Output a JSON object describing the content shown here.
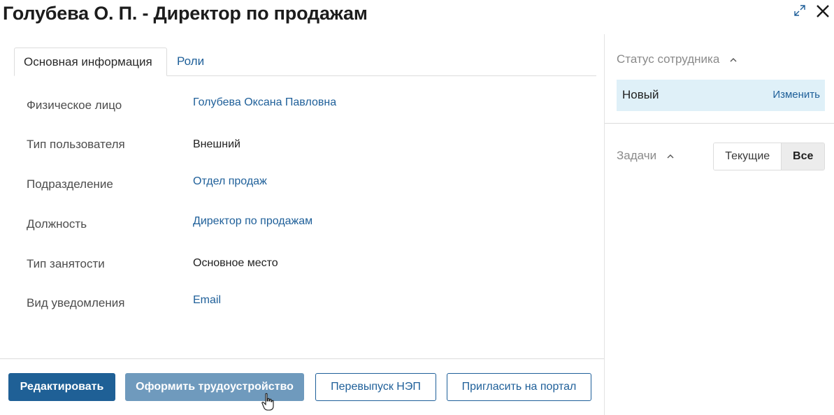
{
  "header": {
    "title": "Голубева О. П. - Директор по продажам"
  },
  "tabs": [
    {
      "label": "Основная информация",
      "active": true
    },
    {
      "label": "Роли",
      "active": false
    }
  ],
  "fields": {
    "individual": {
      "label": "Физическое лицо",
      "value": "Голубева Оксана Павловна"
    },
    "user_type": {
      "label": "Тип пользователя",
      "value": "Внешний"
    },
    "department": {
      "label": "Подразделение",
      "value": "Отдел продаж"
    },
    "position": {
      "label": "Должность",
      "value": "Директор по продажам"
    },
    "employment_type": {
      "label": "Тип занятости",
      "value": "Основное место"
    },
    "notification_type": {
      "label": "Вид уведомления",
      "value": "Email"
    }
  },
  "actions": {
    "edit": "Редактировать",
    "employ": "Оформить трудоустройство",
    "reissue": "Перевыпуск НЭП",
    "invite": "Пригласить на портал"
  },
  "sidebar": {
    "status_heading": "Статус сотрудника",
    "status_value": "Новый",
    "status_change": "Изменить",
    "tasks_heading": "Задачи",
    "tasks_filter": {
      "current": "Текущие",
      "all": "Все",
      "selected": "Все"
    }
  },
  "colors": {
    "accent": "#1f6096",
    "link": "#1e5f99",
    "status_bg": "#dff0f8"
  }
}
